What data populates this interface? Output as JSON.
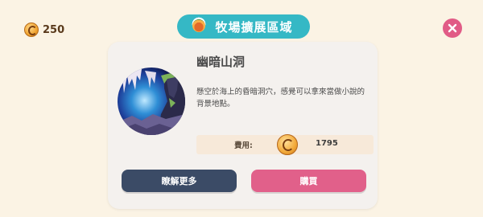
{
  "header": {
    "currency_amount": "250",
    "title": "牧場擴展區域"
  },
  "item": {
    "name": "幽暗山洞",
    "description": "懸空於海上的昏暗洞穴，感覺可以拿來當做小說的背景地點。",
    "cost_label": "費用:",
    "cost_value": "1795"
  },
  "buttons": {
    "learn_more": "瞭解更多",
    "buy": "購買"
  },
  "colors": {
    "title_pill": "#35b8c5",
    "close_button": "#e15b86",
    "learn_button": "#3b4b66",
    "buy_button": "#e1608a"
  },
  "icons": [
    "coin-icon",
    "ranch-icon",
    "close-icon",
    "cave-image"
  ]
}
